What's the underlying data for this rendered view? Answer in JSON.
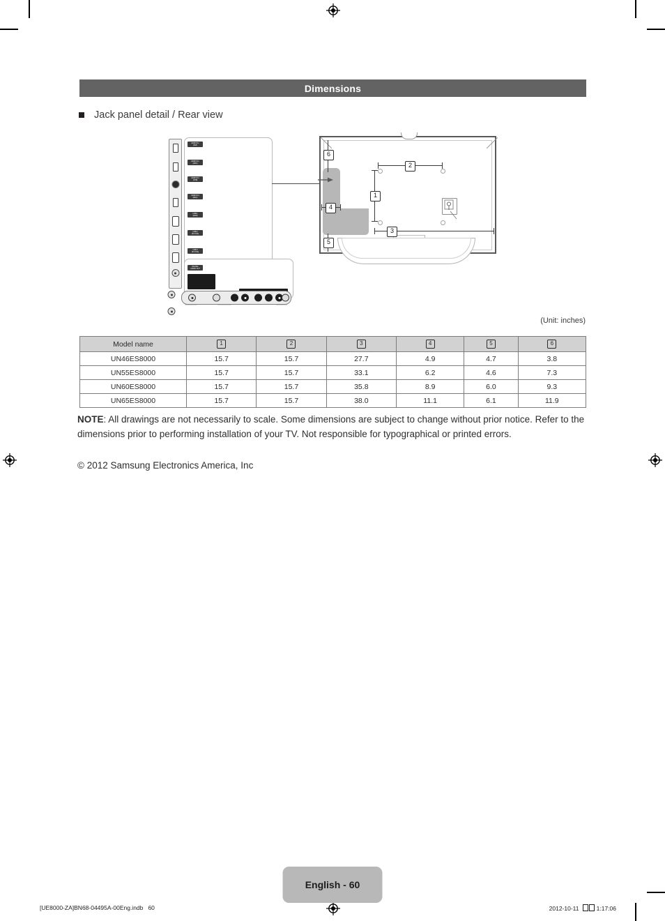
{
  "section": {
    "title": "Dimensions"
  },
  "heading": {
    "bullet_label": "Jack panel detail / Rear view"
  },
  "figure": {
    "unit_label": "(Unit: inches)",
    "dimension_markers": [
      "1",
      "2",
      "3",
      "4",
      "5",
      "6"
    ],
    "jack_panel_name": "jack-panel-detail-drawing",
    "rear_view_name": "tv-rear-view-drawing"
  },
  "table": {
    "headers": [
      "Model name",
      "1",
      "2",
      "3",
      "4",
      "5",
      "6"
    ],
    "rows": [
      {
        "model": "UN46ES8000",
        "values": [
          "15.7",
          "15.7",
          "27.7",
          "4.9",
          "4.7",
          "3.8"
        ]
      },
      {
        "model": "UN55ES8000",
        "values": [
          "15.7",
          "15.7",
          "33.1",
          "6.2",
          "4.6",
          "7.3"
        ]
      },
      {
        "model": "UN60ES8000",
        "values": [
          "15.7",
          "15.7",
          "35.8",
          "8.9",
          "6.0",
          "9.3"
        ]
      },
      {
        "model": "UN65ES8000",
        "values": [
          "15.7",
          "15.7",
          "38.0",
          "11.1",
          "6.1",
          "11.9"
        ]
      }
    ]
  },
  "note": {
    "label": "NOTE",
    "body": ": All drawings are not necessarily to scale. Some dimensions are subject to change without prior notice. Refer to the dimensions prior to performing installation of your TV. Not responsible for typographical or printed errors.",
    "copyright": "© 2012 Samsung Electronics America, Inc"
  },
  "footer": {
    "page_label": "English - 60",
    "file_ref": "[UE8000-ZA]BN68-04495A-00Eng.indb   60",
    "date": "2012-10-11",
    "time": "1:17:06"
  },
  "colors": {
    "section_bar": "#636363",
    "table_header": "#d2d2d2",
    "page_badge": "#b8b8b8",
    "panel_gray": "#b7b7b7"
  }
}
